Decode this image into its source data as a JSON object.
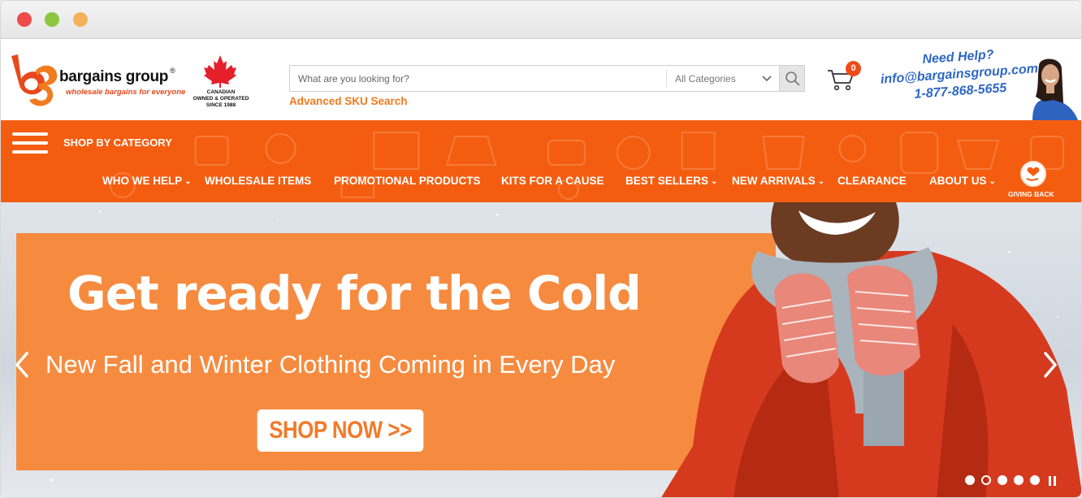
{
  "header": {
    "brand_name": "bargains group",
    "brand_registered": "®",
    "tagline": "wholesale bargains for everyone",
    "canadian_badge": [
      "CANADIAN",
      "OWNED & OPERATED",
      "SINCE 1988"
    ],
    "search": {
      "placeholder": "What are you looking for?",
      "category": "All Categories"
    },
    "advanced_search": "Advanced SKU Search",
    "cart_count": "0",
    "help": {
      "title": "Need Help?",
      "email": "info@bargainsgroup.com",
      "phone": "1-877-868-5655"
    }
  },
  "nav": {
    "shop_by_category": "SHOP BY CATEGORY",
    "items": [
      {
        "label": "WHO WE HELP",
        "has_dropdown": true
      },
      {
        "label": "WHOLESALE ITEMS",
        "has_dropdown": false
      },
      {
        "label": "PROMOTIONAL PRODUCTS",
        "has_dropdown": false
      },
      {
        "label": "KITS FOR A CAUSE",
        "has_dropdown": false
      },
      {
        "label": "BEST SELLERS",
        "has_dropdown": true
      },
      {
        "label": "NEW ARRIVALS",
        "has_dropdown": true
      },
      {
        "label": "CLEARANCE",
        "has_dropdown": false
      },
      {
        "label": "ABOUT US",
        "has_dropdown": true
      }
    ],
    "giving_back": "GIVING BACK"
  },
  "hero": {
    "headline": "Get ready for the Cold",
    "subheadline": "New Fall and Winter Clothing Coming in Every Day",
    "cta": "SHOP NOW >>",
    "slide_count": 5,
    "active_slide": 2
  },
  "colors": {
    "brand_orange": "#f45d10",
    "banner_orange": "#f68b40",
    "link_orange": "#f07a1f",
    "help_blue": "#2e67c5",
    "badge_red": "#ef4c16"
  }
}
